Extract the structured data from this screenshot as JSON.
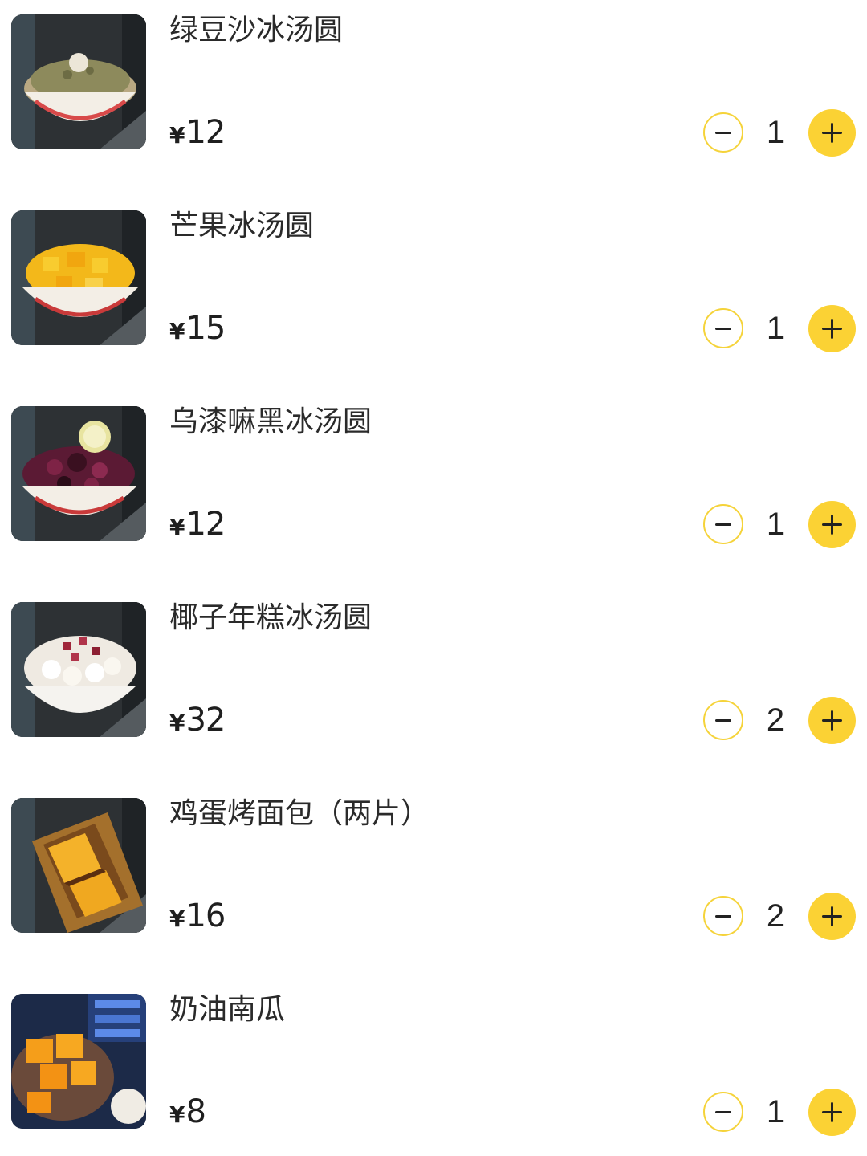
{
  "cart": {
    "items": [
      {
        "name": "绿豆沙冰汤圆",
        "currency": "¥",
        "price": "12",
        "quantity": "1",
        "image": "mung-bean-ice-dessert-photo"
      },
      {
        "name": "芒果冰汤圆",
        "currency": "¥",
        "price": "15",
        "quantity": "1",
        "image": "mango-ice-dessert-photo"
      },
      {
        "name": "乌漆嘛黑冰汤圆",
        "currency": "¥",
        "price": "12",
        "quantity": "1",
        "image": "black-sesame-berry-ice-dessert-photo"
      },
      {
        "name": "椰子年糕冰汤圆",
        "currency": "¥",
        "price": "32",
        "quantity": "2",
        "image": "coconut-rice-cake-ice-dessert-photo"
      },
      {
        "name": "鸡蛋烤面包（两片）",
        "currency": "¥",
        "price": "16",
        "quantity": "2",
        "image": "egg-toast-photo"
      },
      {
        "name": "奶油南瓜",
        "currency": "¥",
        "price": "8",
        "quantity": "1",
        "image": "cream-pumpkin-photo"
      }
    ]
  },
  "icons": {
    "decrement": "minus-icon",
    "increment": "plus-icon"
  },
  "colors": {
    "accent": "#fbd234",
    "outline": "#f5d33a",
    "text": "#222222"
  }
}
